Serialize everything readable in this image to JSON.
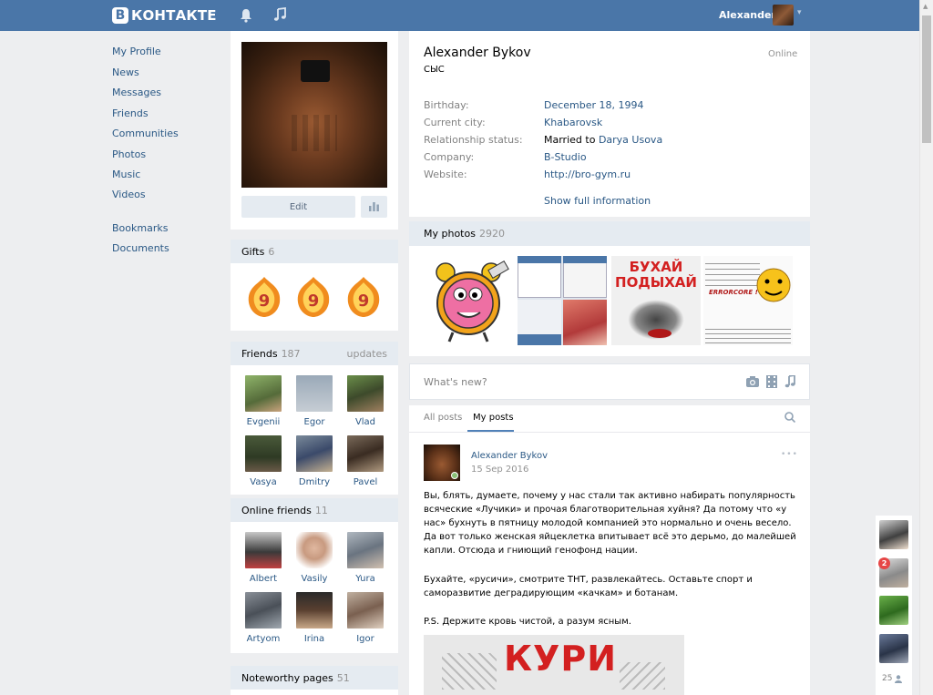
{
  "header": {
    "logo_letter": "В",
    "logo_text": "КОНТАКТЕ",
    "user_name": "Alexander"
  },
  "nav": {
    "items": [
      {
        "label": "My Profile"
      },
      {
        "label": "News"
      },
      {
        "label": "Messages"
      },
      {
        "label": "Friends"
      },
      {
        "label": "Communities"
      },
      {
        "label": "Photos"
      },
      {
        "label": "Music"
      },
      {
        "label": "Videos"
      },
      {
        "label": "Bookmarks"
      },
      {
        "label": "Documents"
      }
    ]
  },
  "profile_actions": {
    "edit_label": "Edit"
  },
  "gifts": {
    "title": "Gifts",
    "count": "6"
  },
  "friends": {
    "title": "Friends",
    "count": "187",
    "updates_label": "updates",
    "items": [
      {
        "name": "Evgenii"
      },
      {
        "name": "Egor"
      },
      {
        "name": "Vlad"
      },
      {
        "name": "Vasya"
      },
      {
        "name": "Dmitry"
      },
      {
        "name": "Pavel"
      }
    ]
  },
  "online_friends": {
    "title": "Online friends",
    "count": "11",
    "items": [
      {
        "name": "Albert"
      },
      {
        "name": "Vasily"
      },
      {
        "name": "Yura"
      },
      {
        "name": "Artyom"
      },
      {
        "name": "Irina"
      },
      {
        "name": "Igor"
      }
    ]
  },
  "noteworthy": {
    "title": "Noteworthy pages",
    "count": "51"
  },
  "profile": {
    "name": "Alexander Bykov",
    "status": "СЫС",
    "online": "Online",
    "info": [
      {
        "label": "Birthday:",
        "value": "December 18, 1994"
      },
      {
        "label": "Current city:",
        "value": "Khabarovsk"
      },
      {
        "label": "Relationship status:",
        "value_prefix": "Married to",
        "value": "Darya Usova"
      },
      {
        "label": "Company:",
        "value": "B-Studio"
      },
      {
        "label": "Website:",
        "value": "http://bro-gym.ru"
      }
    ],
    "show_full": "Show full information"
  },
  "photos": {
    "title": "My photos",
    "count": "2920",
    "p3_text_line1": "БУХАЙ",
    "p3_text_line2": "ПОДЫХАЙ",
    "p4_text": "ERRORCORE !"
  },
  "composer": {
    "placeholder": "What's new?"
  },
  "wall_tabs": {
    "all": "All posts",
    "mine": "My posts"
  },
  "post": {
    "author": "Alexander Bykov",
    "date": "15 Sep 2016",
    "more": "•••",
    "paragraphs": [
      "Вы, блять, думаете, почему у нас стали так активно набирать популярность всяческие «Лучики» и прочая благотворительная хуйня? Да потому что «у нас» бухнуть в пятницу молодой компанией это нормально и очень весело. Да вот только женская яйцеклетка впитывает всё это дерьмо, до малейшей капли. Отсюда и гниющий генофонд нации.",
      "Бухайте, «русичи», смотрите ТНТ, развлекайтесь. Оставьте спорт и саморазвитие деградирующим «качкам» и ботанам.",
      "P.S. Держите кровь чистой, а разум ясным."
    ],
    "image_text": "КУРИ"
  },
  "dock": {
    "badge": "2",
    "count": "25"
  },
  "colors": {
    "header_bg": "#4a76a8",
    "link": "#2a5885",
    "muted": "#828282",
    "section_bg": "#e5ebf1"
  }
}
